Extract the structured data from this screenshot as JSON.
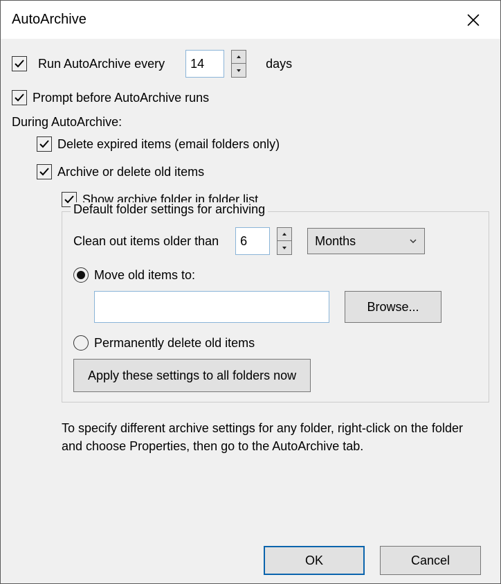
{
  "title": "AutoArchive",
  "run_every": {
    "checked": true,
    "pre_label": "Run AutoArchive every",
    "value": "14",
    "suffix": "days"
  },
  "prompt": {
    "checked": true,
    "label": "Prompt before AutoArchive runs"
  },
  "during_label": "During AutoArchive:",
  "delete_expired": {
    "checked": true,
    "label": "Delete expired items (email folders only)"
  },
  "archive_old": {
    "checked": true,
    "label": "Archive or delete old items"
  },
  "show_folder": {
    "checked": true,
    "label": "Show archive folder in folder list"
  },
  "group": {
    "legend": "Default folder settings for archiving",
    "clean_label": "Clean out items older than",
    "clean_value": "6",
    "unit_selected": "Months",
    "move": {
      "selected": true,
      "label": "Move old items to:",
      "path": ""
    },
    "browse_label": "Browse...",
    "perm_delete": {
      "selected": false,
      "label": "Permanently delete old items"
    },
    "apply_label": "Apply these settings to all folders now"
  },
  "hint": "To specify different archive settings for any folder, right-click on the folder and choose Properties, then go to the AutoArchive tab.",
  "ok_label": "OK",
  "cancel_label": "Cancel"
}
